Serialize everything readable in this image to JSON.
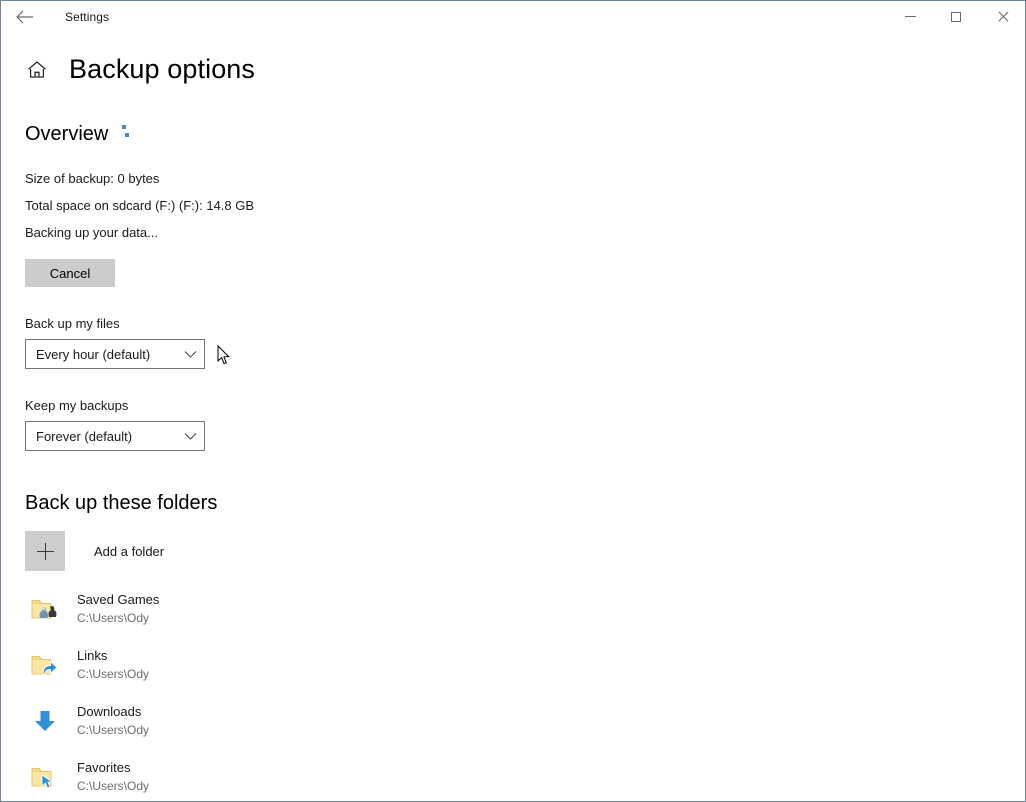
{
  "window": {
    "title": "Settings",
    "back_icon": "back-arrow-icon",
    "minimize_label": "Minimize",
    "maximize_label": "Maximize",
    "close_label": "Close",
    "border_color": "#6f8398"
  },
  "header": {
    "home_icon": "home-icon",
    "page_title": "Backup options"
  },
  "overview": {
    "section_title": "Overview",
    "spinner_icon": "progress-spinner-icon",
    "spinner_color": "#3b86c8",
    "lines": [
      "Size of backup: 0 bytes",
      "Total space on sdcard (F:) (F:): 14.8 GB",
      "Backing up your data..."
    ],
    "cancel_label": "Cancel",
    "cancel_bg": "#cccccc"
  },
  "settings_fields": [
    {
      "label": "Back up my files",
      "value": "Every hour (default)",
      "chevron_icon": "chevron-down-icon"
    },
    {
      "label": "Keep my backups",
      "value": "Forever (default)",
      "chevron_icon": "chevron-down-icon"
    }
  ],
  "folders": {
    "title": "Back up these folders",
    "add_folder_label": "Add a folder",
    "add_folder_icon": "plus-icon",
    "items": [
      {
        "name": "Saved Games",
        "path": "C:\\Users\\Ody",
        "icon": "saved-games-folder-icon"
      },
      {
        "name": "Links",
        "path": "C:\\Users\\Ody",
        "icon": "links-folder-icon"
      },
      {
        "name": "Downloads",
        "path": "C:\\Users\\Ody",
        "icon": "downloads-arrow-icon"
      },
      {
        "name": "Favorites",
        "path": "C:\\Users\\Ody",
        "icon": "favorites-folder-icon"
      }
    ]
  },
  "cursor": {
    "icon": "mouse-pointer-icon"
  }
}
